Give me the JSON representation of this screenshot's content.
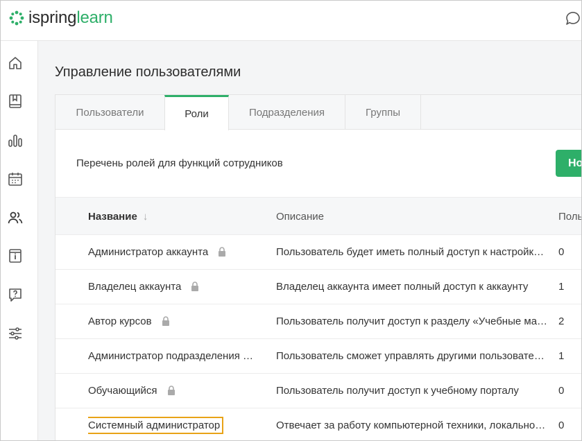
{
  "app": {
    "logo_word1": "ispring",
    "logo_word2": "learn",
    "brand_color": "#2eaf69"
  },
  "sidebar": {
    "items": [
      {
        "icon": "home-icon"
      },
      {
        "icon": "courses-book-icon"
      },
      {
        "icon": "reports-chart-icon"
      },
      {
        "icon": "calendar-icon"
      },
      {
        "icon": "users-icon"
      },
      {
        "icon": "info-icon"
      },
      {
        "icon": "help-icon"
      },
      {
        "icon": "settings-sliders-icon"
      }
    ]
  },
  "page": {
    "title": "Управление пользователями"
  },
  "tabs": [
    {
      "label": "Пользователи",
      "active": false
    },
    {
      "label": "Роли",
      "active": true
    },
    {
      "label": "Подразделения",
      "active": false
    },
    {
      "label": "Группы",
      "active": false
    }
  ],
  "roles": {
    "description": "Перечень ролей для функций сотрудников",
    "new_button_label": "Но"
  },
  "table": {
    "headers": {
      "name": "Название",
      "description": "Описание",
      "users": "Поль"
    },
    "rows": [
      {
        "name": "Администратор аккаунта",
        "locked": true,
        "description": "Пользователь будет иметь полный доступ к настройк…",
        "users": "0"
      },
      {
        "name": "Владелец аккаунта",
        "locked": true,
        "description": "Владелец аккаунта имеет полный доступ к аккаунту",
        "users": "1"
      },
      {
        "name": "Автор курсов",
        "locked": true,
        "description": "Пользователь получит доступ к разделу «Учебные ма…",
        "users": "2"
      },
      {
        "name": "Администратор подразделения …",
        "locked": false,
        "description": "Пользователь сможет управлять другими пользовате…",
        "users": "1"
      },
      {
        "name": "Обучающийся",
        "locked": true,
        "description": "Пользователь получит доступ к учебному порталу",
        "users": "0"
      },
      {
        "name": "Системный администратор",
        "locked": false,
        "highlighted": true,
        "description": "Отвечает за работу компьютерной техники, локально…",
        "users": "0"
      }
    ]
  }
}
